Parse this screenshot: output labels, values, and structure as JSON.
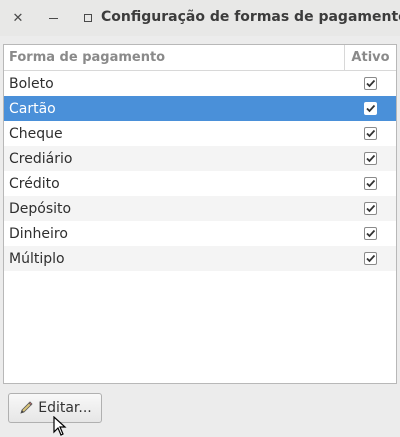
{
  "window": {
    "title": "Configuração de formas de pagamento",
    "close_icon": "close-icon",
    "minimize_icon": "minimize-icon",
    "maximize_icon": "maximize-icon"
  },
  "table": {
    "columns": [
      "Forma de pagamento",
      "Ativo"
    ],
    "rows": [
      {
        "name": "Boleto",
        "active": true,
        "selected": false
      },
      {
        "name": "Cartão",
        "active": true,
        "selected": true
      },
      {
        "name": "Cheque",
        "active": true,
        "selected": false
      },
      {
        "name": "Crediário",
        "active": true,
        "selected": false
      },
      {
        "name": "Crédito",
        "active": true,
        "selected": false
      },
      {
        "name": "Depósito",
        "active": true,
        "selected": false
      },
      {
        "name": "Dinheiro",
        "active": true,
        "selected": false
      },
      {
        "name": "Múltiplo",
        "active": true,
        "selected": false
      }
    ]
  },
  "actions": {
    "edit_label": "Editar...",
    "edit_icon": "pencil-icon"
  },
  "colors": {
    "selection": "#4a90d9",
    "alt_row": "#f4f4f4"
  }
}
